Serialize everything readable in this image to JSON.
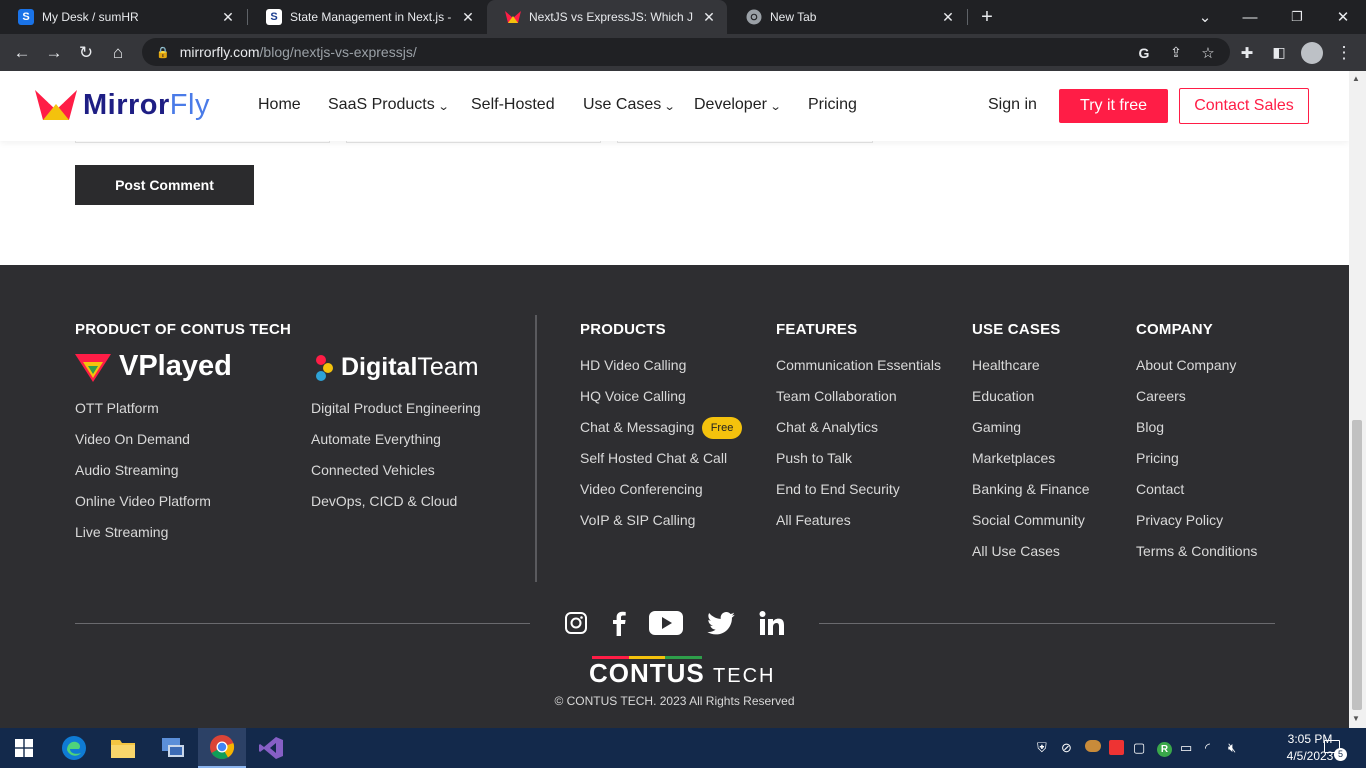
{
  "browser": {
    "tabs": [
      {
        "title": "My Desk / sumHR",
        "favicon": "S"
      },
      {
        "title": "State Management in Next.js - Al",
        "favicon": "S"
      },
      {
        "title": "NextJS vs ExpressJS: Which JavaS",
        "favicon": "mirrorfly-icon"
      },
      {
        "title": "New Tab",
        "favicon": "chrome-icon"
      }
    ],
    "new_tab": "+",
    "url_host": "mirrorfly.com",
    "url_path": "/blog/nextjs-vs-expressjs/"
  },
  "header": {
    "logo_text_a": "Mirror",
    "logo_text_b": "Fly",
    "menu": [
      "Home",
      "SaaS Products",
      "Self-Hosted",
      "Use Cases",
      "Developer",
      "Pricing"
    ],
    "sign_in": "Sign in",
    "try_free": "Try it free",
    "contact_sales": "Contact Sales"
  },
  "comment": {
    "post_button": "Post Comment"
  },
  "footer": {
    "product_of": "PRODUCT OF CONTUS TECH",
    "vplayed_logo": "VPlayed",
    "digital_logo_a": "Digital",
    "digital_logo_b": "Team",
    "vplayed_links": [
      "OTT Platform",
      "Video On Demand",
      "Audio Streaming",
      "Online Video Platform",
      "Live Streaming"
    ],
    "digital_links": [
      "Digital Product Engineering",
      "Automate Everything",
      "Connected Vehicles",
      "DevOps, CICD & Cloud"
    ],
    "products": {
      "heading": "PRODUCTS",
      "links": [
        "HD Video Calling",
        "HQ Voice Calling",
        "Chat & Messaging",
        "Self Hosted Chat & Call",
        "Video Conferencing",
        "VoIP & SIP Calling"
      ]
    },
    "free_badge": "Free",
    "features": {
      "heading": "FEATURES",
      "links": [
        "Communication Essentials",
        "Team Collaboration",
        "Chat & Analytics",
        "Push to Talk",
        "End to End Security",
        "All Features"
      ]
    },
    "use_cases": {
      "heading": "USE CASES",
      "links": [
        "Healthcare",
        "Education",
        "Gaming",
        "Marketplaces",
        "Banking & Finance",
        "Social Community",
        "All Use Cases"
      ]
    },
    "company": {
      "heading": "COMPANY",
      "links": [
        "About Company",
        "Careers",
        "Blog",
        "Pricing",
        "Contact",
        "Privacy Policy",
        "Terms & Conditions"
      ]
    },
    "social": [
      "instagram-icon",
      "facebook-icon",
      "youtube-icon",
      "twitter-icon",
      "linkedin-icon"
    ],
    "contus_a": "CONTUS",
    "contus_b": "TECH",
    "copyright": "© CONTUS TECH. 2023 All Rights Reserved"
  },
  "taskbar": {
    "time": "3:05 PM",
    "date": "4/5/2023",
    "notifications": "5"
  },
  "colors": {
    "brand_red": "#ff1d46",
    "footer_bg": "#2e2e31",
    "badge_yellow": "#f4c20d"
  }
}
